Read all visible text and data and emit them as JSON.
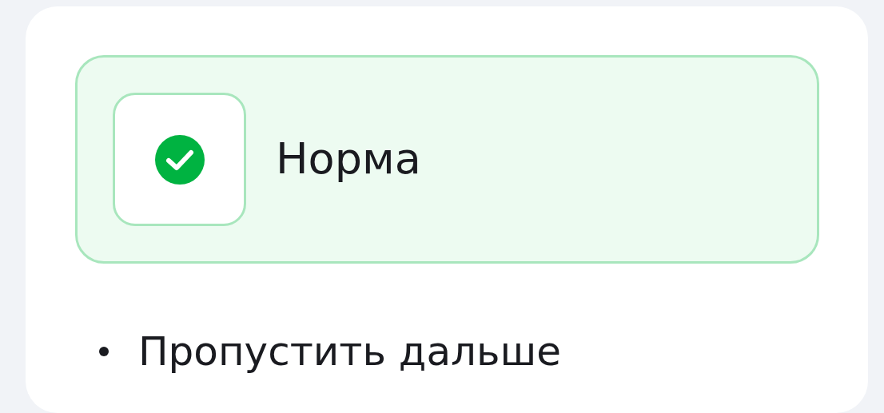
{
  "status": {
    "kind": "ok",
    "label": "Норма"
  },
  "actions": [
    "Пропустить дальше"
  ]
}
